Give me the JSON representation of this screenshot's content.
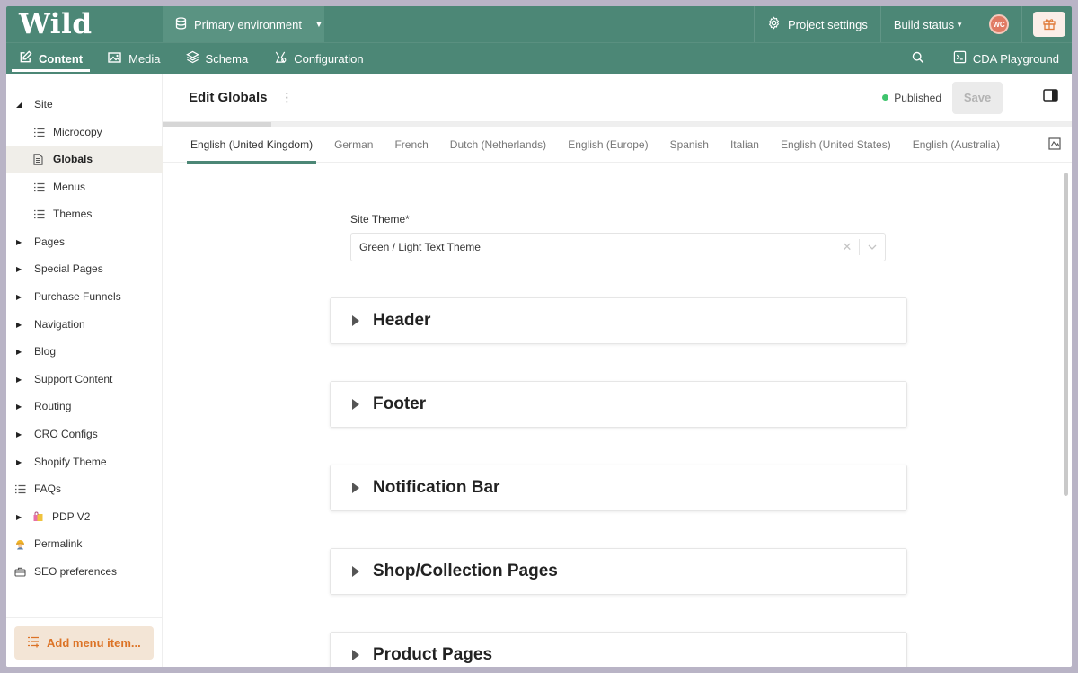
{
  "topbar": {
    "logo": "Wild",
    "environment": "Primary environment",
    "project_settings": "Project settings",
    "build_status": "Build status",
    "avatar_initials": "WC"
  },
  "nav": {
    "items": [
      {
        "label": "Content",
        "icon": "edit-icon",
        "active": true
      },
      {
        "label": "Media",
        "icon": "image-icon"
      },
      {
        "label": "Schema",
        "icon": "layers-icon"
      },
      {
        "label": "Configuration",
        "icon": "wrench-icon"
      }
    ],
    "cda_playground": "CDA Playground"
  },
  "sidebar": {
    "items": [
      {
        "label": "Site",
        "type": "parent-open"
      },
      {
        "label": "Microcopy",
        "type": "child"
      },
      {
        "label": "Globals",
        "type": "child",
        "selected": true
      },
      {
        "label": "Menus",
        "type": "child"
      },
      {
        "label": "Themes",
        "type": "child"
      },
      {
        "label": "Pages",
        "type": "parent"
      },
      {
        "label": "Special Pages",
        "type": "parent"
      },
      {
        "label": "Purchase Funnels",
        "type": "parent"
      },
      {
        "label": "Navigation",
        "type": "parent"
      },
      {
        "label": "Blog",
        "type": "parent"
      },
      {
        "label": "Support Content",
        "type": "parent"
      },
      {
        "label": "Routing",
        "type": "parent"
      },
      {
        "label": "CRO Configs",
        "type": "parent"
      },
      {
        "label": "Shopify Theme",
        "type": "parent"
      },
      {
        "label": "FAQs",
        "type": "list"
      },
      {
        "label": "PDP V2",
        "type": "parent-bag"
      },
      {
        "label": "Permalink",
        "type": "worker"
      },
      {
        "label": "SEO preferences",
        "type": "toolbox"
      }
    ],
    "add_menu_item": "Add menu item..."
  },
  "main": {
    "title": "Edit Globals",
    "status": "Published",
    "save_label": "Save",
    "progress": 0.12,
    "languages": [
      "English (United Kingdom)",
      "German",
      "French",
      "Dutch (Netherlands)",
      "English (Europe)",
      "Spanish",
      "Italian",
      "English (United States)",
      "English (Australia)"
    ],
    "active_language": "English (United Kingdom)",
    "site_theme_label": "Site Theme*",
    "site_theme_value": "Green / Light Text Theme",
    "sections": [
      "Header",
      "Footer",
      "Notification Bar",
      "Shop/Collection Pages",
      "Product Pages"
    ]
  },
  "colors": {
    "brand": "#4c8776",
    "accent_orange": "#dc7326",
    "status_green": "#3fc46d"
  }
}
